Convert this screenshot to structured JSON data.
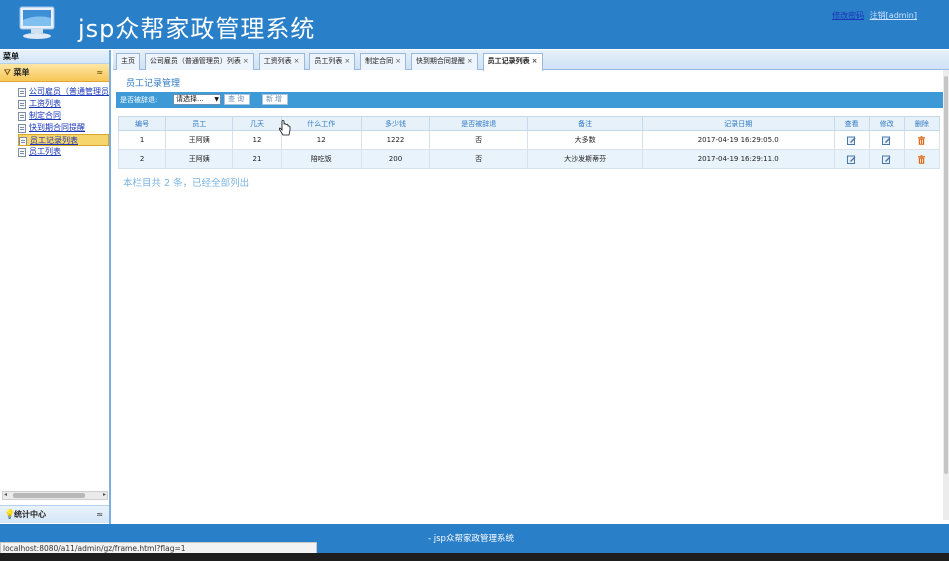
{
  "header": {
    "title": "jsp众帮家政管理系统",
    "link_change_password": "修改密码",
    "link_logout": "注销[admin]"
  },
  "sidebar": {
    "top_title": "菜单",
    "menu_label": "菜单",
    "items": [
      {
        "label": "公司雇员（普通管理员"
      },
      {
        "label": "工资列表"
      },
      {
        "label": "制定合同"
      },
      {
        "label": "快到期合同提醒"
      },
      {
        "label": "员工记录列表"
      },
      {
        "label": "员工列表"
      }
    ],
    "active_index": 4,
    "bottom_label": "统计中心"
  },
  "tabs": [
    {
      "label": "主页",
      "closable": false
    },
    {
      "label": "公司雇员（普通管理员）列表",
      "closable": true
    },
    {
      "label": "工资列表",
      "closable": true
    },
    {
      "label": "员工列表",
      "closable": true
    },
    {
      "label": "制定合同",
      "closable": true
    },
    {
      "label": "快到期合同提醒",
      "closable": true
    },
    {
      "label": "员工记录列表",
      "closable": true
    }
  ],
  "active_tab": 6,
  "main": {
    "section_title": "员工记录管理",
    "search": {
      "label": "是否被辞退:",
      "select_value": "请选择...",
      "query_button": "查询",
      "add_button": "新增"
    },
    "columns": [
      "编号",
      "员工",
      "几天",
      "什么工作",
      "多少钱",
      "是否被辞退",
      "备注",
      "记录日期",
      "查看",
      "修改",
      "删除"
    ],
    "rows": [
      {
        "id": "1",
        "employee": "王阿姨",
        "days": "12",
        "work": "12",
        "money": "1222",
        "dismissed": "否",
        "note": "大多数",
        "date": "2017-04-19 16:29:05.0"
      },
      {
        "id": "2",
        "employee": "王阿姨",
        "days": "21",
        "work": "陪吃饭",
        "money": "200",
        "dismissed": "否",
        "note": "大沙发斯蒂芬",
        "date": "2017-04-19 16:29:11.0"
      }
    ],
    "summary": "本栏目共 2 条，已经全部列出"
  },
  "footer": {
    "text": "- jsp众帮家政管理系统"
  },
  "status_url": "localhost:8080/a11/admin/gz/frame.html?flag=1",
  "colors": {
    "brand_blue": "#2a7fc9",
    "search_bar": "#3d9ad6",
    "highlight": "#f7d56d",
    "delete_icon": "#e06a1c"
  }
}
